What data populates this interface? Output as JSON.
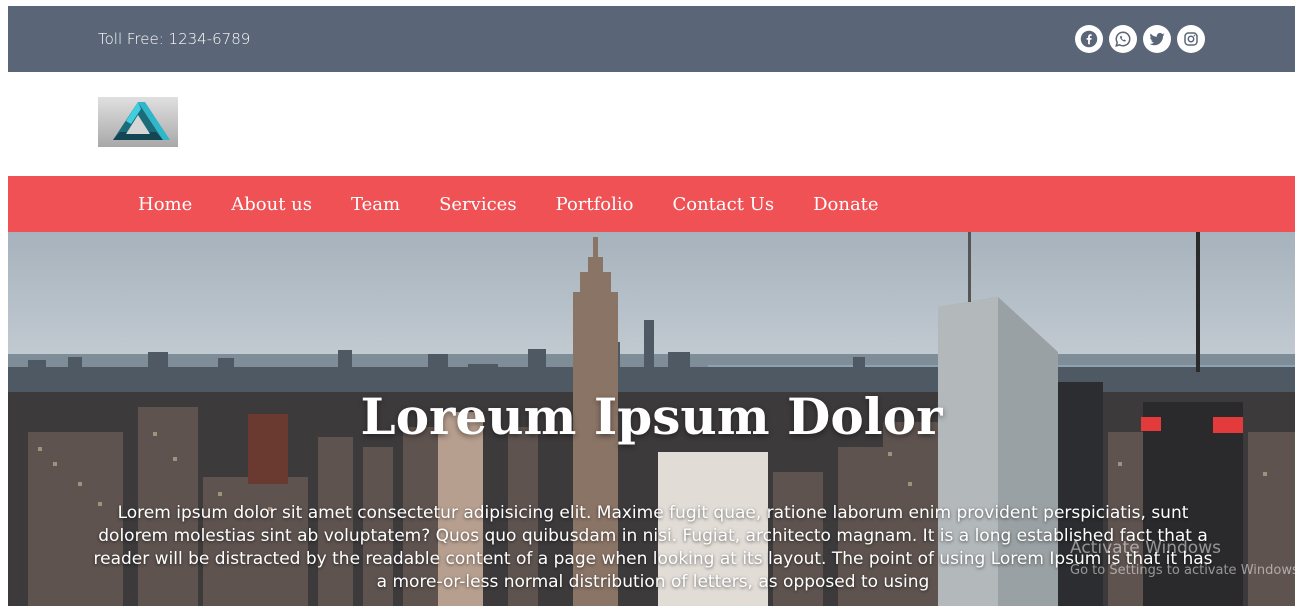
{
  "topbar": {
    "toll_free": "Toll Free: 1234-6789",
    "socials": [
      {
        "icon": "facebook-icon"
      },
      {
        "icon": "whatsapp-icon"
      },
      {
        "icon": "twitter-icon"
      },
      {
        "icon": "instagram-icon"
      }
    ],
    "background_color": "#5a6677"
  },
  "logo": {
    "icon": "penrose-triangle-logo"
  },
  "navbar": {
    "background_color": "#ef5155",
    "items": [
      "Home",
      "About us",
      "Team",
      "Services",
      "Portfolio",
      "Contact Us",
      "Donate"
    ]
  },
  "hero": {
    "title": "Loreum Ipsum Dolor",
    "text": "Lorem ipsum dolor sit amet consectetur adipisicing elit. Maxime fugit quae, ratione laborum enim provident perspiciatis, sunt dolorem molestias sint ab voluptatem? Quos quo quibusdam in nisi. Fugiat, architecto magnam. It is a long established fact that a reader will be distracted by the readable content of a page when looking at its layout. The point of using Lorem Ipsum is that it has a more-or-less normal distribution of letters, as opposed to using"
  },
  "watermark": {
    "line1": "Activate Windows",
    "line2": "Go to Settings to activate Windows."
  }
}
